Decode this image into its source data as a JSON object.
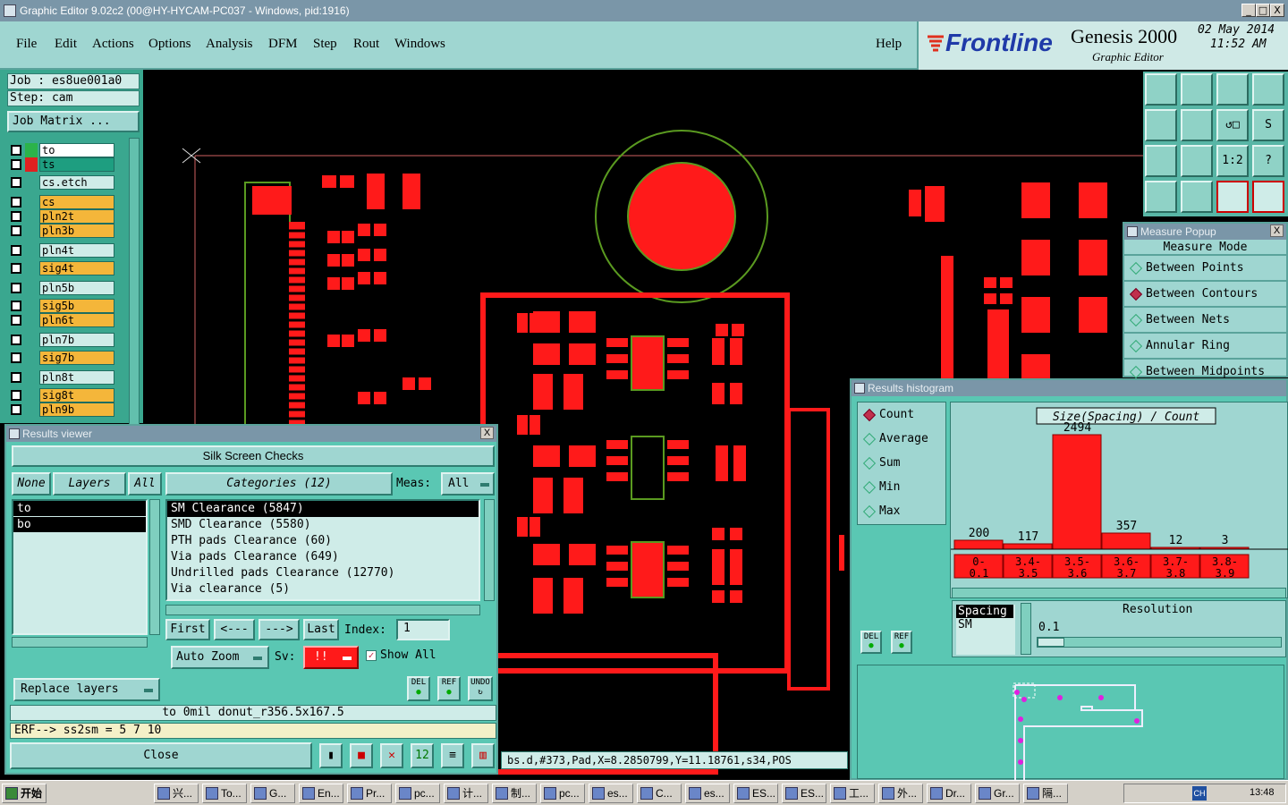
{
  "window": {
    "title": "Graphic Editor 9.02c2 (00@HY-HYCAM-PC037 - Windows, pid:1916)",
    "min": "_",
    "max": "□",
    "close": "X"
  },
  "menu": [
    "File",
    "Edit",
    "Actions",
    "Options",
    "Analysis",
    "DFM",
    "Step",
    "Rout",
    "Windows"
  ],
  "help": "Help",
  "brand": {
    "logo": "Frontline",
    "product": "Genesis 2000",
    "subtitle": "Graphic Editor",
    "date": "02 May 2014",
    "time": "11:52 AM"
  },
  "job": {
    "job": "Job : es8ue001a0",
    "step": "Step: cam",
    "matrix": "Job Matrix ..."
  },
  "layers": [
    {
      "name": "to",
      "color": "#ffffff",
      "swatch": "#2bb34a"
    },
    {
      "name": "ts",
      "color": "#1e9e80",
      "swatch": "#e02020"
    },
    {
      "name": "cs.etch",
      "color": "#cfece8",
      "swatch": ""
    },
    {
      "name": "cs",
      "color": "#f4b63a",
      "swatch": ""
    },
    {
      "name": "pln2t",
      "color": "#f4b63a",
      "swatch": ""
    },
    {
      "name": "pln3b",
      "color": "#f4b63a",
      "swatch": ""
    },
    {
      "name": "pln4t",
      "color": "#cfece8",
      "swatch": ""
    },
    {
      "name": "sig4t",
      "color": "#f4b63a",
      "swatch": ""
    },
    {
      "name": "pln5b",
      "color": "#cfece8",
      "swatch": ""
    },
    {
      "name": "sig5b",
      "color": "#f4b63a",
      "swatch": ""
    },
    {
      "name": "pln6t",
      "color": "#f4b63a",
      "swatch": ""
    },
    {
      "name": "pln7b",
      "color": "#cfece8",
      "swatch": ""
    },
    {
      "name": "sig7b",
      "color": "#f4b63a",
      "swatch": ""
    },
    {
      "name": "pln8t",
      "color": "#cfece8",
      "swatch": ""
    },
    {
      "name": "sig8t",
      "color": "#f4b63a",
      "swatch": ""
    },
    {
      "name": "pln9b",
      "color": "#f4b63a",
      "swatch": ""
    }
  ],
  "toolbar_icons": [
    "zoom-home-icon",
    "zoom-in-icon",
    "zoom-fit-icon",
    "window-icon",
    "pan-left-icon",
    "pan-right-icon",
    "zoom-prev-icon",
    "snap-icon",
    "fit-icon",
    "center-icon",
    "scale-icon",
    "help-icon",
    "tools-icon",
    "grid-icon",
    "layers-icon",
    "layers2-icon"
  ],
  "toolbar_labels": [
    "",
    "",
    "",
    "",
    "",
    "",
    "↺□",
    "S",
    "",
    "",
    "1:2",
    "?",
    "",
    "",
    "",
    ""
  ],
  "measure": {
    "title": "Measure Popup",
    "mode_header": "Measure Mode",
    "modes": [
      "Between Points",
      "Between Contours",
      "Between Nets",
      "Annular Ring",
      "Between Midpoints"
    ],
    "selected": 1
  },
  "results_viewer": {
    "title": "Results viewer",
    "header": "Silk Screen Checks",
    "none": "None",
    "layers": "Layers",
    "all": "All",
    "categories_label": "Categories (12)",
    "meas_label": "Meas:",
    "meas_value": "All",
    "layer_items": [
      "to",
      "bo"
    ],
    "categories": [
      "SM Clearance (5847)",
      "SMD Clearance (5580)",
      "PTH pads Clearance (60)",
      "Via pads Clearance (649)",
      "Undrilled pads Clearance (12770)",
      "Via clearance (5)"
    ],
    "nav": {
      "first": "First",
      "prev": "<---",
      "next": "--->",
      "last": "Last",
      "index_label": "Index:",
      "index_value": "1"
    },
    "auto_zoom": "Auto Zoom",
    "sv": "Sv:",
    "sv_value": "!!",
    "show_all": "Show All",
    "replace_layers": "Replace layers",
    "del": "DEL",
    "ref": "REF",
    "undo": "UNDO",
    "info_line": "to 0mil donut_r356.5x167.5",
    "erf_line": "ERF--> ss2sm = 5 7 10",
    "close": "Close"
  },
  "status_line": "bs.d,#373,Pad,X=8.2850799,Y=11.18761,s34,POS",
  "histogram": {
    "title": "Results histogram",
    "options": [
      "Count",
      "Average",
      "Sum",
      "Min",
      "Max"
    ],
    "selected": 0,
    "del": "DEL",
    "ref": "REF",
    "chart_title": "Size(Spacing) / Count",
    "spacing_label": "Spacing",
    "sm_label": "SM",
    "resolution_label": "Resolution",
    "resolution_value": "0.1"
  },
  "chart_data": {
    "type": "bar",
    "title": "Size(Spacing) / Count",
    "categories": [
      "0-0.1",
      "3.4-3.5",
      "3.5-3.6",
      "3.6-3.7",
      "3.7-3.8",
      "3.8-3.9"
    ],
    "values": [
      200,
      117,
      2494,
      357,
      12,
      3
    ],
    "color": "#ff1a1a"
  },
  "taskbar": {
    "start": "开始",
    "items": [
      "兴...",
      "To...",
      "G...",
      "En...",
      "Pr...",
      "pc...",
      "计...",
      "制...",
      "pc...",
      "es...",
      "C...",
      "es...",
      "ES...",
      "ES...",
      "工...",
      "外...",
      "Dr...",
      "Gr...",
      "隔..."
    ],
    "clock": "13:48",
    "lang": "CH"
  }
}
